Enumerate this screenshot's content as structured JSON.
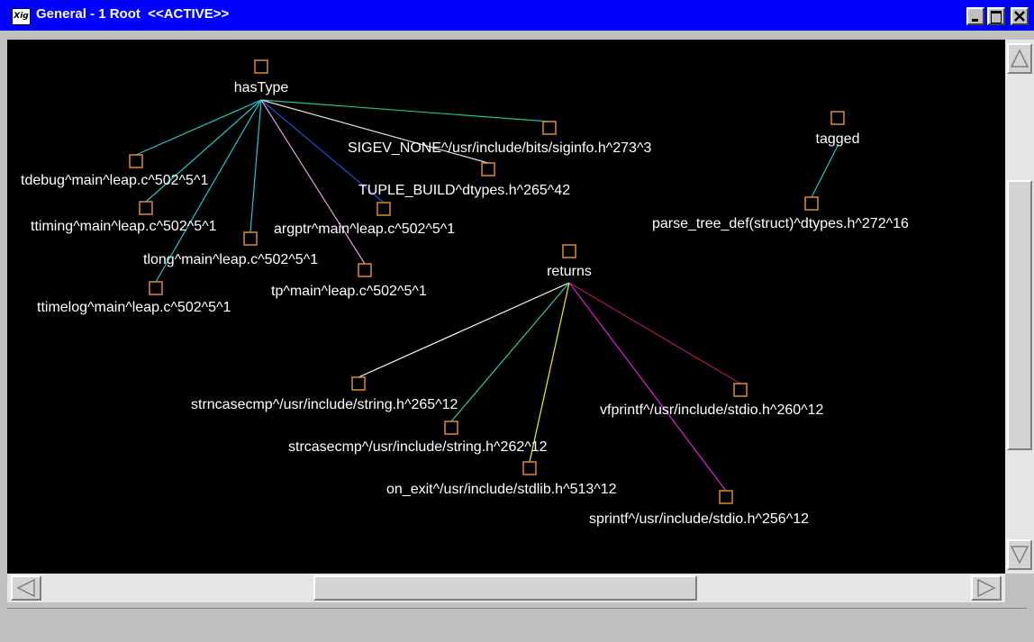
{
  "window": {
    "app_icon_label": "Xig",
    "title": "General - 1 Root  <<ACTIVE>>",
    "status_text": ""
  },
  "colors": {
    "title_bar": "#0000ff",
    "canvas_bg": "#000000",
    "label_text": "#ffffff",
    "node_stroke": "#e08a3a"
  },
  "graph": {
    "parents": [
      {
        "id": "hasType",
        "label": "hasType"
      },
      {
        "id": "tagged",
        "label": "tagged"
      },
      {
        "id": "returns",
        "label": "returns"
      }
    ],
    "children": [
      {
        "id": "sigev",
        "parent": "hasType",
        "label": "SIGEV_NONE^/usr/include/bits/siginfo.h^273^3",
        "edge_color": "#20c0a0"
      },
      {
        "id": "tuple",
        "parent": "hasType",
        "label": "TUPLE_BUILD^dtypes.h^265^42",
        "edge_color": "#e0e0e0"
      },
      {
        "id": "tdebug",
        "parent": "hasType",
        "label": "tdebug^main^leap.c^502^5^1",
        "edge_color": "#20c8c8"
      },
      {
        "id": "ttiming",
        "parent": "hasType",
        "label": "ttiming^main^leap.c^502^5^1",
        "edge_color": "#20c8c8"
      },
      {
        "id": "tlong",
        "parent": "hasType",
        "label": "tlong^main^leap.c^502^5^1",
        "edge_color": "#20c8c8"
      },
      {
        "id": "ttimelog",
        "parent": "hasType",
        "label": "ttimelog^main^leap.c^502^5^1",
        "edge_color": "#20c8c8"
      },
      {
        "id": "argptr",
        "parent": "hasType",
        "label": "argptr^main^leap.c^502^5^1",
        "edge_color": "#2a4ad8"
      },
      {
        "id": "tp",
        "parent": "hasType",
        "label": "tp^main^leap.c^502^5^1",
        "edge_color": "#e0a0e0"
      },
      {
        "id": "parsetree",
        "parent": "tagged",
        "label": "parse_tree_def(struct)^dtypes.h^272^16",
        "edge_color": "#20c8c8"
      },
      {
        "id": "strncasecmp",
        "parent": "returns",
        "label": "strncasecmp^/usr/include/string.h^265^12",
        "edge_color": "#ffffff"
      },
      {
        "id": "strcasecmp",
        "parent": "returns",
        "label": "strcasecmp^/usr/include/string.h^262^12",
        "edge_color": "#30c8b0"
      },
      {
        "id": "onexit",
        "parent": "returns",
        "label": "on_exit^/usr/include/stdlib.h^513^12",
        "edge_color": "#f0f020"
      },
      {
        "id": "vfprintf",
        "parent": "returns",
        "label": "vfprintf^/usr/include/stdio.h^260^12",
        "edge_color": "#b0106a"
      },
      {
        "id": "sprintf",
        "parent": "returns",
        "label": "sprintf^/usr/include/stdio.h^256^12",
        "edge_color": "#e020e0"
      }
    ]
  }
}
